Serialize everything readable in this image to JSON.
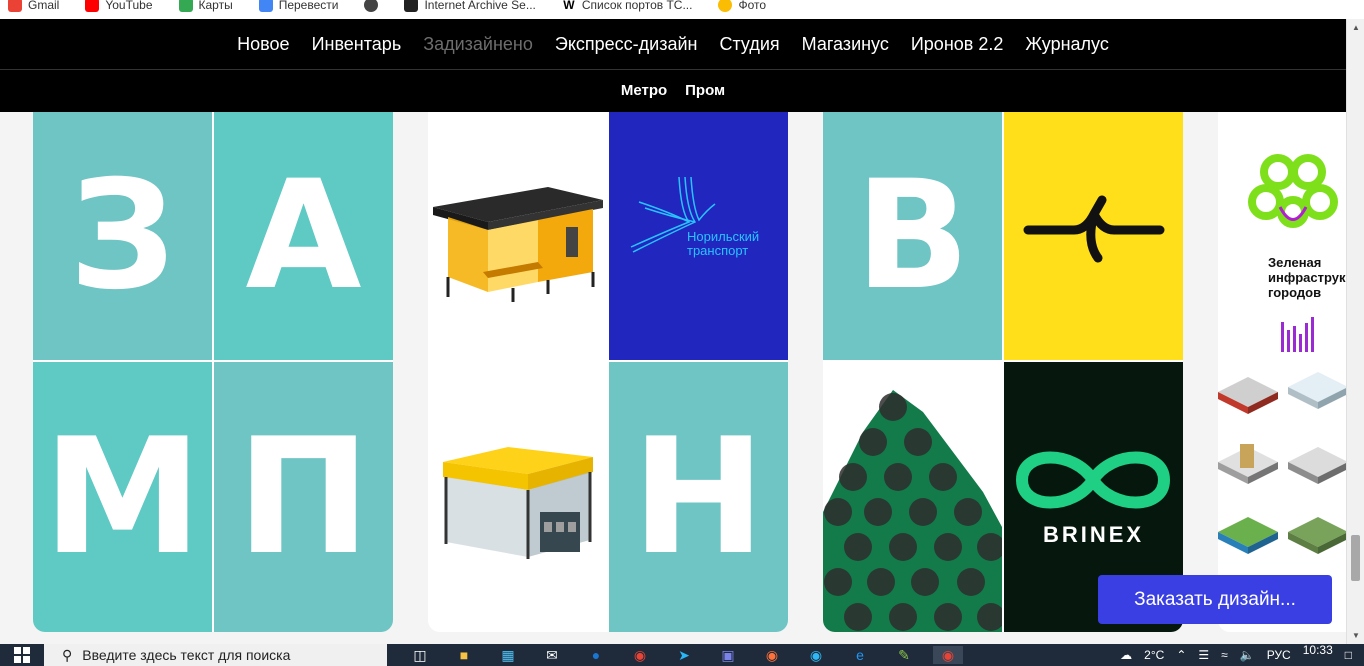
{
  "bookmarks": [
    {
      "label": "Gmail",
      "color": "#ea4335"
    },
    {
      "label": "YouTube",
      "color": "#ff0000"
    },
    {
      "label": "Карты",
      "color": "#34a853"
    },
    {
      "label": "Перевести",
      "color": "#4285f4"
    },
    {
      "label": "",
      "color": "#444444"
    },
    {
      "label": "Internet Archive Se...",
      "color": "#222222"
    },
    {
      "label": "Список портов TC...",
      "color": "#ffffff"
    },
    {
      "label": "Фото",
      "color": "#fbbc04"
    }
  ],
  "nav": {
    "main": [
      {
        "label": "Новое",
        "active": false
      },
      {
        "label": "Инвентарь",
        "active": false
      },
      {
        "label": "Задизайнено",
        "active": true
      },
      {
        "label": "Экспресс-дизайн",
        "active": false
      },
      {
        "label": "Студия",
        "active": false
      },
      {
        "label": "Магазинус",
        "active": false
      },
      {
        "label": "Иронов 2.2",
        "active": false
      },
      {
        "label": "Журналус",
        "active": false
      }
    ],
    "sub": [
      "Метро",
      "Пром"
    ]
  },
  "cards": {
    "zamp": {
      "letters": [
        "З",
        "А",
        "М",
        "П"
      ]
    },
    "norilsk": {
      "logo_line1": "Норильский",
      "logo_line2": "транспорт",
      "letter": "Н"
    },
    "brinex": {
      "letter": "В",
      "brand": "BRINEX"
    },
    "green": {
      "line1": "Зеленая",
      "line2": "инфраструк",
      "line3": "городов"
    }
  },
  "cta": {
    "label": "Заказать дизайн..."
  },
  "taskbar": {
    "search_placeholder": "Введите здесь текст для поиска",
    "weather": "2°C",
    "lang": "РУС",
    "time": "10:33"
  },
  "colors": {
    "teal": "#6fc4c4",
    "blue": "#2026be",
    "yellow": "#ffde1a",
    "cta": "#3a3fe4"
  }
}
